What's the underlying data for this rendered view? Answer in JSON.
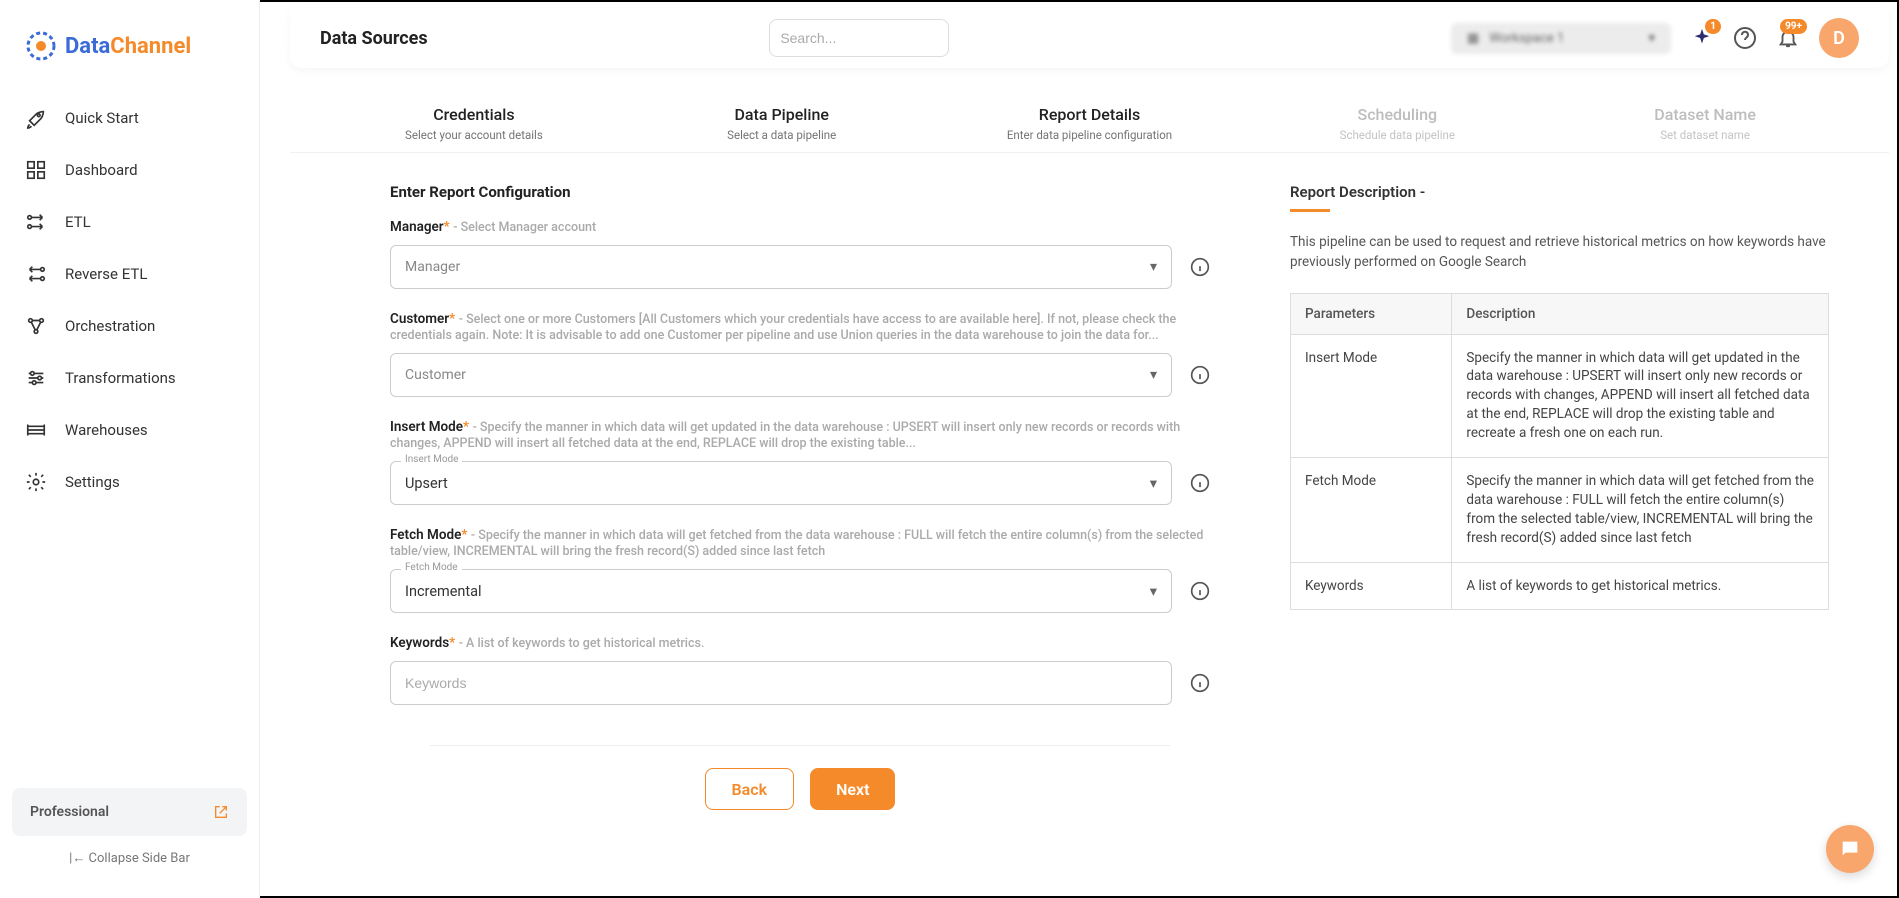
{
  "logo": {
    "text1": "Data",
    "text2": "Channel"
  },
  "sidebar": {
    "items": [
      {
        "label": "Quick Start"
      },
      {
        "label": "Dashboard"
      },
      {
        "label": "ETL"
      },
      {
        "label": "Reverse ETL"
      },
      {
        "label": "Orchestration"
      },
      {
        "label": "Transformations"
      },
      {
        "label": "Warehouses"
      },
      {
        "label": "Settings"
      }
    ],
    "plan": "Professional",
    "collapse": "Collapse Side Bar"
  },
  "header": {
    "title": "Data Sources",
    "search_placeholder": "Search...",
    "workspace": "Workspace 1",
    "sparkle_badge": "1",
    "bell_badge": "99+",
    "avatar": "D"
  },
  "steps": [
    {
      "title": "Credentials",
      "sub": "Select your account details",
      "active": true
    },
    {
      "title": "Data Pipeline",
      "sub": "Select a data pipeline",
      "active": true
    },
    {
      "title": "Report Details",
      "sub": "Enter data pipeline configuration",
      "active": true
    },
    {
      "title": "Scheduling",
      "sub": "Schedule data pipeline",
      "active": false
    },
    {
      "title": "Dataset Name",
      "sub": "Set dataset name",
      "active": false
    }
  ],
  "form": {
    "heading": "Enter Report Configuration",
    "fields": {
      "manager": {
        "label": "Manager",
        "hint": "- Select Manager account",
        "value": "Manager"
      },
      "customer": {
        "label": "Customer",
        "hint": "- Select one or more Customers [All Customers which your credentials have access to are available here]. If not, please check the credentials again. Note: It is advisable to add one Customer per pipeline and use Union queries in the data warehouse to join the data for...",
        "value": "Customer"
      },
      "insert_mode": {
        "label": "Insert Mode",
        "hint": "- Specify the manner in which data will get updated in the data warehouse : UPSERT will insert only new records or records with changes, APPEND will insert all fetched data at the end, REPLACE will drop the existing table...",
        "float": "Insert Mode",
        "value": "Upsert"
      },
      "fetch_mode": {
        "label": "Fetch Mode",
        "hint": "- Specify the manner in which data will get fetched from the data warehouse : FULL will fetch the entire column(s) from the selected table/view, INCREMENTAL will bring the fresh record(S) added since last fetch",
        "float": "Fetch Mode",
        "value": "Incremental"
      },
      "keywords": {
        "label": "Keywords",
        "hint": "- A list of keywords to get historical metrics.",
        "placeholder": "Keywords"
      }
    },
    "back": "Back",
    "next": "Next"
  },
  "description": {
    "heading": "Report Description -",
    "text": "This pipeline can be used to request and retrieve historical metrics on how keywords have previously performed on Google Search",
    "table": {
      "headers": [
        "Parameters",
        "Description"
      ],
      "rows": [
        [
          "Insert Mode",
          "Specify the manner in which data will get updated in the data warehouse : UPSERT will insert only new records or records with changes, APPEND will insert all fetched data at the end, REPLACE will drop the existing table and recreate a fresh one on each run."
        ],
        [
          "Fetch Mode",
          "Specify the manner in which data will get fetched from the data warehouse : FULL will fetch the entire column(s) from the selected table/view, INCREMENTAL will bring the fresh record(S) added since last fetch"
        ],
        [
          "Keywords",
          "A list of keywords to get historical metrics."
        ]
      ]
    }
  }
}
